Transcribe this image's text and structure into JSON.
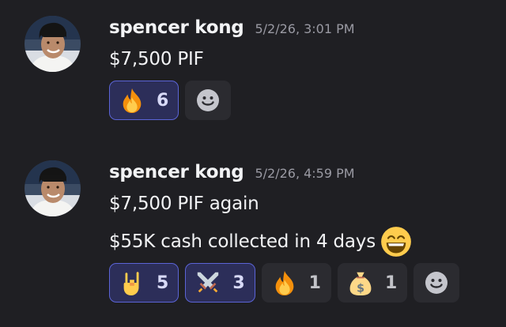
{
  "messages": [
    {
      "username": "spencer kong",
      "timestamp": "5/2/26, 3:01 PM",
      "lines": [
        "$7,500 PIF"
      ],
      "reactions": [
        {
          "emoji": "fire-emoji",
          "count": "6",
          "active": true
        }
      ]
    },
    {
      "username": "spencer kong",
      "timestamp": "5/2/26, 4:59 PM",
      "lines": [
        "$7,500 PIF again",
        "$55K cash collected in 4 days"
      ],
      "inline_emoji": "grinning-face-emoji",
      "reactions": [
        {
          "emoji": "sign-of-horns-emoji",
          "count": "5",
          "active": true
        },
        {
          "emoji": "crossed-swords-emoji",
          "count": "3",
          "active": true
        },
        {
          "emoji": "fire-emoji",
          "count": "1",
          "active": false
        },
        {
          "emoji": "money-bag-emoji",
          "count": "1",
          "active": false
        }
      ]
    }
  ],
  "add_reaction_icon": "add-reaction-smiley-icon",
  "colors": {
    "background": "#1f1f23",
    "reaction_active_bg": "#2c2e59",
    "reaction_active_border": "#5b64d6",
    "reaction_bg": "#2b2b30",
    "timestamp": "#9a9aa3"
  }
}
